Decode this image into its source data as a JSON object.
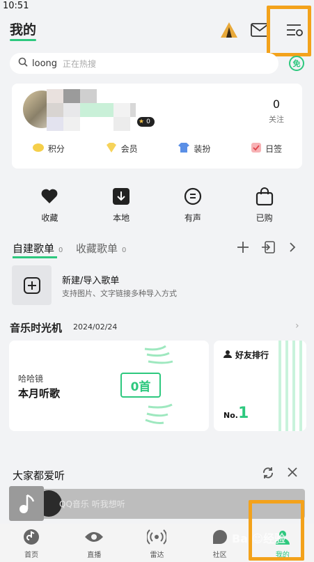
{
  "status_bar": {
    "time": "10:51"
  },
  "header": {
    "title": "我的"
  },
  "search": {
    "query": "loong",
    "hint": "正在热搜",
    "free_badge": "免"
  },
  "profile": {
    "level_badge": "0",
    "follow_count": "0",
    "follow_label": "关注",
    "perks": [
      {
        "label": "积分",
        "icon": "points-icon"
      },
      {
        "label": "会员",
        "icon": "vip-diamond-icon"
      },
      {
        "label": "装扮",
        "icon": "tshirt-icon"
      },
      {
        "label": "日签",
        "icon": "daily-sign-icon"
      }
    ]
  },
  "quick_actions": [
    {
      "label": "收藏",
      "icon": "heart-icon"
    },
    {
      "label": "本地",
      "icon": "download-icon"
    },
    {
      "label": "有声",
      "icon": "audiobook-icon"
    },
    {
      "label": "已购",
      "icon": "bag-icon"
    }
  ],
  "playlists": {
    "tab_created": "自建歌单",
    "tab_created_count": "0",
    "tab_collected": "收藏歌单",
    "tab_collected_count": "0",
    "new_title": "新建/导入歌单",
    "new_desc": "支持图片、文字链接多种导入方式"
  },
  "time_machine": {
    "title": "音乐时光机",
    "date": "2024/02/24",
    "month_sub": "哈哈镜",
    "month_title": "本月听歌",
    "month_count": "0首",
    "friends_title": "好友排行",
    "rank_prefix": "No.",
    "rank_value": "1"
  },
  "recommend": {
    "title": "大家都爱听"
  },
  "player": {
    "song": "QQ音乐 听我想听"
  },
  "bottom_nav": [
    {
      "label": "首页",
      "icon": "home-icon"
    },
    {
      "label": "直播",
      "icon": "eye-icon"
    },
    {
      "label": "雷达",
      "icon": "radar-icon"
    },
    {
      "label": "社区",
      "icon": "community-icon"
    },
    {
      "label": "我的",
      "icon": "profile-icon"
    }
  ],
  "watermark": "Bai☺经验",
  "colors": {
    "accent": "#2dc87e",
    "highlight": "#f3a21b",
    "background": "#f2f3f5"
  }
}
